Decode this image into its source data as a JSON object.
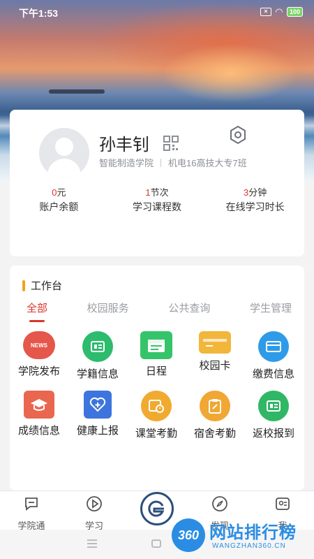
{
  "status_bar": {
    "time": "下午1:53",
    "battery": "100"
  },
  "profile": {
    "name": "孙丰钊",
    "college": "智能制造学院",
    "class": "机电16高技大专7班"
  },
  "stats": [
    {
      "value": "0",
      "unit": "元",
      "label": "账户余额"
    },
    {
      "value": "1",
      "unit": "节次",
      "label": "学习课程数"
    },
    {
      "value": "3",
      "unit": "分钟",
      "label": "在线学习时长"
    }
  ],
  "workbench": {
    "title": "工作台",
    "tabs": [
      "全部",
      "校园服务",
      "公共查询",
      "学生管理"
    ],
    "active_tab": "全部",
    "apps": [
      {
        "label": "学院发布",
        "icon": "news-icon",
        "badge": "NEWS",
        "color": "#e4574a"
      },
      {
        "label": "学籍信息",
        "icon": "student-card-icon",
        "color": "#2dbb6e"
      },
      {
        "label": "日程",
        "icon": "calendar-icon",
        "color": "#35c46a"
      },
      {
        "label": "校园卡",
        "icon": "campus-card-icon",
        "color": "#f2b63b"
      },
      {
        "label": "缴费信息",
        "icon": "payment-card-icon",
        "color": "#2e9be8"
      },
      {
        "label": "成绩信息",
        "icon": "graduation-cap-icon",
        "color": "#e9674f"
      },
      {
        "label": "健康上报",
        "icon": "heart-plus-icon",
        "color": "#3d74de"
      },
      {
        "label": "课堂考勤",
        "icon": "calendar-clock-icon",
        "color": "#f0aa30"
      },
      {
        "label": "宿舍考勤",
        "icon": "clipboard-edit-icon",
        "color": "#f0a733"
      },
      {
        "label": "返校报到",
        "icon": "id-card-icon",
        "color": "#30b766"
      }
    ]
  },
  "bottom_nav": {
    "items": [
      {
        "label": "学院通",
        "icon": "chat-bubble-icon"
      },
      {
        "label": "学习",
        "icon": "play-circle-icon"
      },
      {
        "label": "发现",
        "icon": "compass-icon"
      },
      {
        "label": "我",
        "icon": "user-card-icon"
      }
    ]
  },
  "watermark": {
    "badge": "360",
    "text": "网站排行榜",
    "sub": "WANGZHAN360.CN"
  }
}
